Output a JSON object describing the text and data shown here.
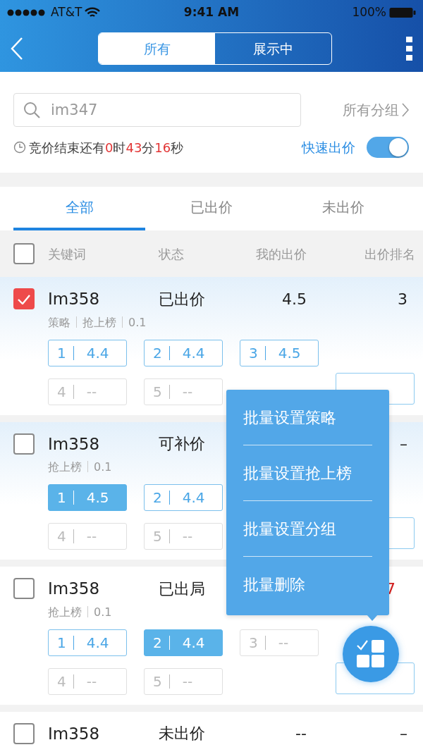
{
  "status_bar": {
    "carrier": "AT&T",
    "time": "9:41 AM",
    "battery": "100%"
  },
  "nav": {
    "segments": [
      {
        "label": "所有",
        "selected": true
      },
      {
        "label": "展示中",
        "selected": false
      }
    ]
  },
  "search": {
    "placeholder": "im347",
    "group_link": "所有分组"
  },
  "countdown": [
    {
      "text": "竞价结束还有",
      "kind": "label"
    },
    {
      "text": "0",
      "kind": "value"
    },
    {
      "text": "时",
      "kind": "label"
    },
    {
      "text": "43",
      "kind": "value"
    },
    {
      "text": "分",
      "kind": "label"
    },
    {
      "text": "16",
      "kind": "value"
    },
    {
      "text": "秒",
      "kind": "label"
    }
  ],
  "quick_bid": {
    "label": "快速出价",
    "on": true
  },
  "tabs": [
    {
      "label": "全部",
      "selected": true
    },
    {
      "label": "已出价",
      "selected": false
    },
    {
      "label": "未出价",
      "selected": false
    }
  ],
  "table": {
    "select_all_checked": false,
    "columns": [
      "关键词",
      "状态",
      "我的出价",
      "出价排名"
    ],
    "rows": [
      {
        "checked": true,
        "highlighted": true,
        "keyword": "Im358",
        "status": "已出价",
        "my_bid": "4.5",
        "rank": "3",
        "rank_alert": false,
        "tags": [
          "策略",
          "抢上榜",
          "0.1"
        ],
        "slots": [
          {
            "kind": "outline",
            "number": "1",
            "price": "4.4"
          },
          {
            "kind": "outline",
            "number": "2",
            "price": "4.4"
          },
          {
            "kind": "outline",
            "number": "3",
            "price": "4.5"
          },
          {
            "kind": "empty",
            "number": "4",
            "price": "--"
          },
          {
            "kind": "empty",
            "number": "5",
            "price": "--"
          }
        ],
        "bid_button": {}
      },
      {
        "checked": false,
        "highlighted": true,
        "keyword": "Im358",
        "status": "可补价",
        "rank": "–",
        "rank_alert": false,
        "tags": [
          "抢上榜",
          "0.1"
        ],
        "slots": [
          {
            "kind": "selected",
            "number": "1",
            "price": "4.5"
          },
          {
            "kind": "outline",
            "number": "2",
            "price": "4.4"
          },
          {
            "kind": "empty",
            "number": "4",
            "price": "--",
            "new_line": true
          },
          {
            "kind": "empty",
            "number": "5",
            "price": "--"
          }
        ],
        "bid_button": {}
      },
      {
        "checked": false,
        "highlighted": false,
        "keyword": "Im358",
        "status": "已出局",
        "rank": "7",
        "rank_alert": true,
        "tags": [
          "抢上榜",
          "0.1"
        ],
        "slots": [
          {
            "kind": "outline",
            "number": "1",
            "price": "4.4"
          },
          {
            "kind": "selected",
            "number": "2",
            "price": "4.4"
          },
          {
            "kind": "empty",
            "number": "3",
            "price": "--"
          },
          {
            "kind": "empty",
            "number": "4",
            "price": "--"
          },
          {
            "kind": "empty",
            "number": "5",
            "price": "--"
          }
        ],
        "bid_button": {}
      },
      {
        "checked": false,
        "highlighted": false,
        "keyword": "Im358",
        "status": "未出价",
        "my_bid": "--",
        "rank": "–",
        "rank_alert": false
      }
    ]
  },
  "batch_menu": {
    "items": [
      "批量设置策略",
      "批量设置抢上榜",
      "批量设置分组",
      "批量删除"
    ]
  }
}
